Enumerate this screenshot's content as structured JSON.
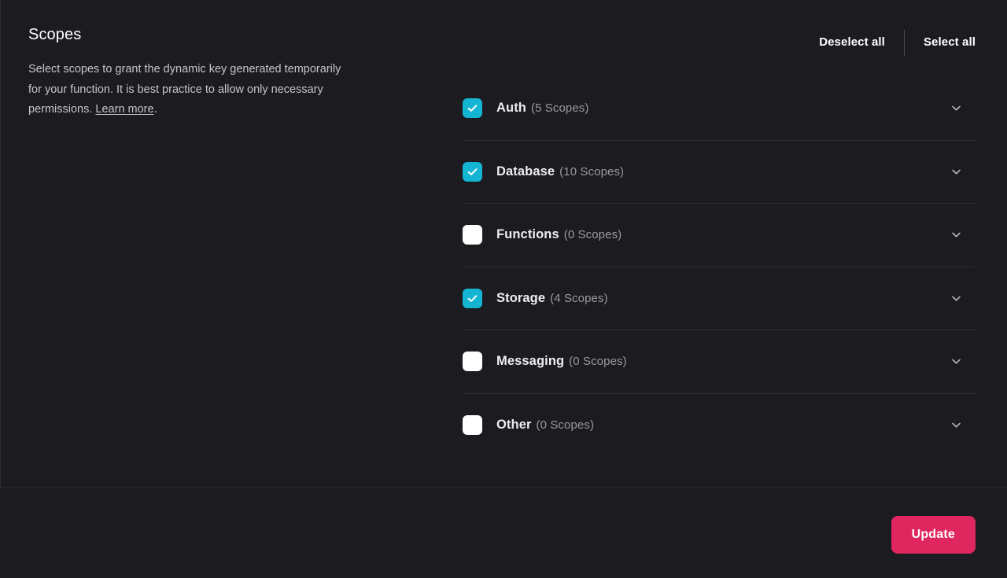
{
  "panel": {
    "title": "Scopes",
    "description_before_link": "Select scopes to grant the dynamic key generated temporarily for your function. It is best practice to allow only necessary permissions. ",
    "link_label": "Learn more",
    "description_after_link": "."
  },
  "actions": {
    "deselect_all": "Deselect all",
    "select_all": "Select all"
  },
  "scopes": [
    {
      "name": "Auth",
      "count": "(5 Scopes)",
      "checked": true,
      "expand_icon": "chevron-down-icon"
    },
    {
      "name": "Database",
      "count": "(10 Scopes)",
      "checked": true,
      "expand_icon": "chevron-down-icon"
    },
    {
      "name": "Functions",
      "count": "(0 Scopes)",
      "checked": false,
      "expand_icon": "chevron-down-icon"
    },
    {
      "name": "Storage",
      "count": "(4 Scopes)",
      "checked": true,
      "expand_icon": "chevron-down-icon"
    },
    {
      "name": "Messaging",
      "count": "(0 Scopes)",
      "checked": false,
      "expand_icon": "chevron-down-icon"
    },
    {
      "name": "Other",
      "count": "(0 Scopes)",
      "checked": false,
      "expand_icon": "chevron-down-icon"
    }
  ],
  "footer": {
    "update_label": "Update"
  },
  "colors": {
    "background": "#1b1b20",
    "checkbox_checked": "#14b4d3",
    "checkbox_unchecked": "#ffffff",
    "primary_button": "#e0265e",
    "divider": "#2e2e35",
    "muted_text": "#9a9aa2",
    "body_text": "#c5c5ca"
  }
}
